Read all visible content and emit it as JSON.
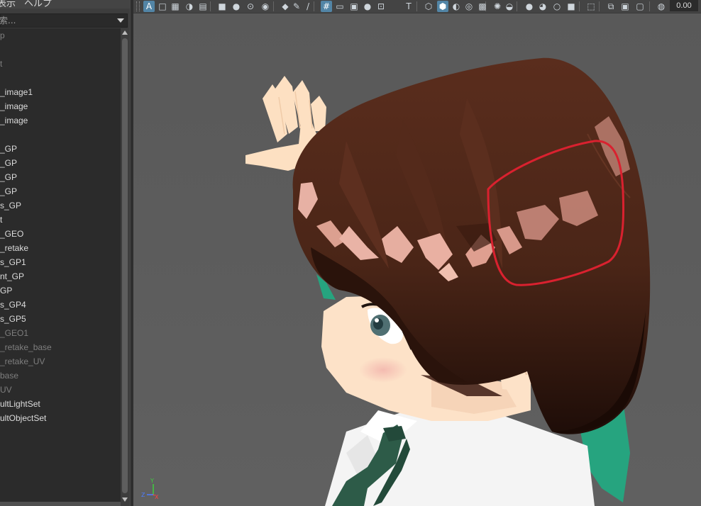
{
  "menu": {
    "display_label": "表示",
    "help_label": "ヘルプ"
  },
  "outliner": {
    "search_placeholder": "索...",
    "items": [
      {
        "label": "p",
        "dim": true
      },
      {
        "label": "",
        "dim": true
      },
      {
        "label": "t",
        "dim": true
      },
      {
        "label": "",
        "dim": true
      },
      {
        "label": "_image1",
        "dim": false
      },
      {
        "label": "_image",
        "dim": false
      },
      {
        "label": "_image",
        "dim": false
      },
      {
        "label": "",
        "dim": false
      },
      {
        "label": "_GP",
        "dim": false
      },
      {
        "label": "_GP",
        "dim": false
      },
      {
        "label": "_GP",
        "dim": false
      },
      {
        "label": "_GP",
        "dim": false
      },
      {
        "label": "s_GP",
        "dim": false
      },
      {
        "label": "t",
        "dim": false
      },
      {
        "label": "_GEO",
        "dim": false
      },
      {
        "label": "_retake",
        "dim": false
      },
      {
        "label": "s_GP1",
        "dim": false
      },
      {
        "label": "nt_GP",
        "dim": false
      },
      {
        "label": "GP",
        "dim": false
      },
      {
        "label": "s_GP4",
        "dim": false
      },
      {
        "label": "s_GP5",
        "dim": false
      },
      {
        "label": "_GEO1",
        "dim": true
      },
      {
        "label": "_retake_base",
        "dim": true
      },
      {
        "label": "_retake_UV",
        "dim": true
      },
      {
        "label": "base",
        "dim": true
      },
      {
        "label": "UV",
        "dim": true
      },
      {
        "label": "ultLightSet",
        "dim": false
      },
      {
        "label": "ultObjectSet",
        "dim": false
      }
    ]
  },
  "toolbar": {
    "value": "0.00",
    "icons": [
      "select-camera-icon",
      "camera-attributes-icon",
      "bookmark-icon",
      "image-plane-icon",
      "2d-pan-zoom-icon",
      "camera-icon",
      "lock-camera-icon",
      "camera-attr-icon",
      "snapshot-icon",
      "bookmark-flag-icon",
      "grease-pencil-icon",
      "pencil-icon",
      "grid-icon",
      "film-gate-icon",
      "resolution-gate-icon",
      "gate-mask-icon",
      "field-chart-icon",
      "safe-action-icon",
      "wireframe-icon",
      "smooth-shade-icon",
      "default-material-icon",
      "shaded-wireframe-icon",
      "textured-icon",
      "lighting-icon",
      "shadows-icon",
      "ambient-occlusion-icon",
      "motion-blur-icon",
      "anti-aliasing-icon",
      "depth-of-field-icon",
      "isolate-select-icon",
      "xray-icon",
      "xray-joints-icon",
      "xray-components-icon",
      "camera-exposure-icon"
    ]
  },
  "viewport": {
    "annotation_color": "#d9212f",
    "axis_labels": {
      "y": "Y",
      "z": "Z",
      "x": "X"
    }
  }
}
